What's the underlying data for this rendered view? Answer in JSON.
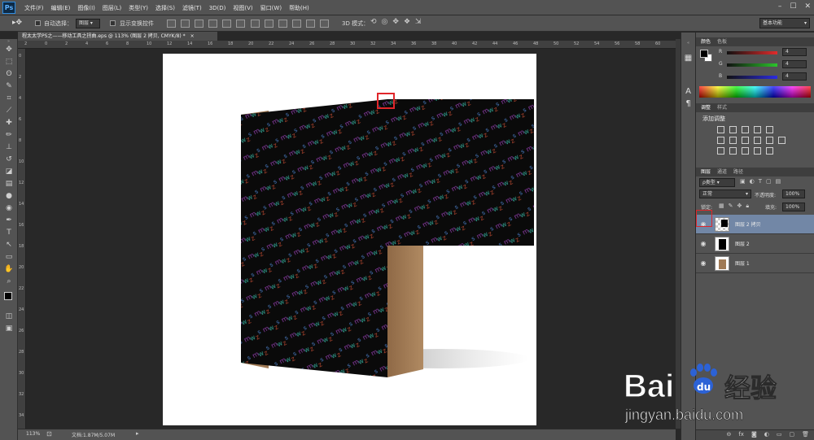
{
  "app": {
    "logo": "Ps"
  },
  "menus": [
    "文件(F)",
    "编辑(E)",
    "图像(I)",
    "图层(L)",
    "类型(Y)",
    "选择(S)",
    "滤镜(T)",
    "3D(D)",
    "视图(V)",
    "窗口(W)",
    "帮助(H)"
  ],
  "window_controls": {
    "minimize": "–",
    "maximize": "☐",
    "close": "✕"
  },
  "options": {
    "auto_select_label": "自动选择：",
    "auto_select_value": "图层",
    "show_transform_label": "显示变换控件",
    "mode_3d_label": "3D 模式：",
    "workspace": "基本功能"
  },
  "document": {
    "tab_title": "程太太学PS之——移动工具之拐曲.eps @ 113% (图层 2 拷贝, CMYK/8) *",
    "close": "×"
  },
  "ruler": {
    "h_ticks": [
      "2",
      "0",
      "2",
      "4",
      "6",
      "8",
      "10",
      "12",
      "14",
      "16",
      "18",
      "20",
      "22",
      "24",
      "26",
      "28",
      "30",
      "32",
      "34",
      "36",
      "38",
      "40",
      "42",
      "44",
      "46",
      "48",
      "50",
      "52",
      "54",
      "56",
      "58",
      "60"
    ],
    "v_ticks": [
      "0",
      "2",
      "4",
      "6",
      "8",
      "10",
      "12",
      "14",
      "16",
      "18",
      "20",
      "22",
      "24",
      "26",
      "28",
      "30",
      "32",
      "34"
    ]
  },
  "status": {
    "zoom": "113%",
    "doc_info": "文档:1.87M/5.07M"
  },
  "color_panel": {
    "tabs": [
      "颜色",
      "色板"
    ],
    "channels": [
      {
        "label": "R",
        "value": "4",
        "color": "#e12b2b"
      },
      {
        "label": "G",
        "value": "4",
        "color": "#2bc42b"
      },
      {
        "label": "B",
        "value": "4",
        "color": "#2b2be1"
      }
    ]
  },
  "adjust_panel": {
    "tabs": [
      "调整",
      "样式"
    ],
    "title": "添加调整"
  },
  "layers_panel": {
    "tabs": [
      "图层",
      "通道",
      "路径"
    ],
    "kind_filter": "ρ类型",
    "blend_mode": "正常",
    "opacity_label": "不透明度:",
    "opacity_value": "100%",
    "lock_label": "锁定:",
    "fill_label": "填充:",
    "fill_value": "100%",
    "layers": [
      {
        "name": "图层 2 拷贝",
        "selected": true
      },
      {
        "name": "图层 2",
        "selected": false
      },
      {
        "name": "图层 1",
        "selected": false
      }
    ],
    "bottom_icons": [
      "link-icon",
      "fx-icon",
      "mask-icon",
      "adjustment-icon",
      "group-icon",
      "new-layer-icon",
      "trash-icon"
    ]
  },
  "watermark": {
    "logo_text": "Bai",
    "logo_text2": "du",
    "brand": "经验",
    "url": "jingyan.baidu.com"
  },
  "colors": {
    "accent_red": "#e0262a",
    "box_tan": "#a07a55",
    "selected_layer": "#7287a6"
  }
}
